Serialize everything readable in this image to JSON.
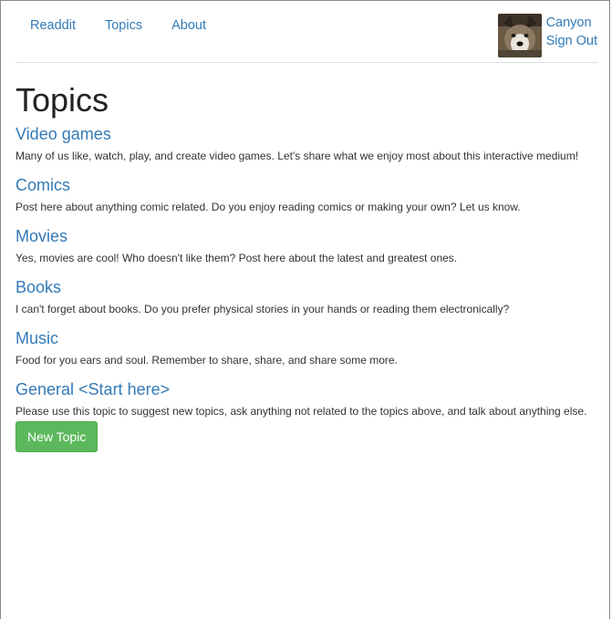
{
  "navbar": {
    "links": [
      {
        "label": "Readdit"
      },
      {
        "label": "Topics"
      },
      {
        "label": "About"
      }
    ],
    "user": {
      "name": "Canyon",
      "sign_out_label": "Sign Out"
    }
  },
  "page": {
    "title": "Topics"
  },
  "topics": [
    {
      "title": "Video games",
      "description": "Many of us like, watch, play, and create video games. Let's share what we enjoy most about this interactive medium!"
    },
    {
      "title": "Comics",
      "description": "Post here about anything comic related. Do you enjoy reading comics or making your own? Let us know."
    },
    {
      "title": "Movies",
      "description": "Yes, movies are cool! Who doesn't like them? Post here about the latest and greatest ones."
    },
    {
      "title": "Books",
      "description": "I can't forget about books. Do you prefer physical stories in your hands or reading them electronically?"
    },
    {
      "title": "Music",
      "description": "Food for you ears and soul. Remember to share, share, and share some more."
    },
    {
      "title": "General <Start here>",
      "description": "Please use this topic to suggest new topics, ask anything not related to the topics above, and talk about anything else."
    }
  ],
  "actions": {
    "new_topic_label": "New Topic"
  },
  "colors": {
    "link": "#337ab7",
    "button_success": "#5cb85c"
  }
}
